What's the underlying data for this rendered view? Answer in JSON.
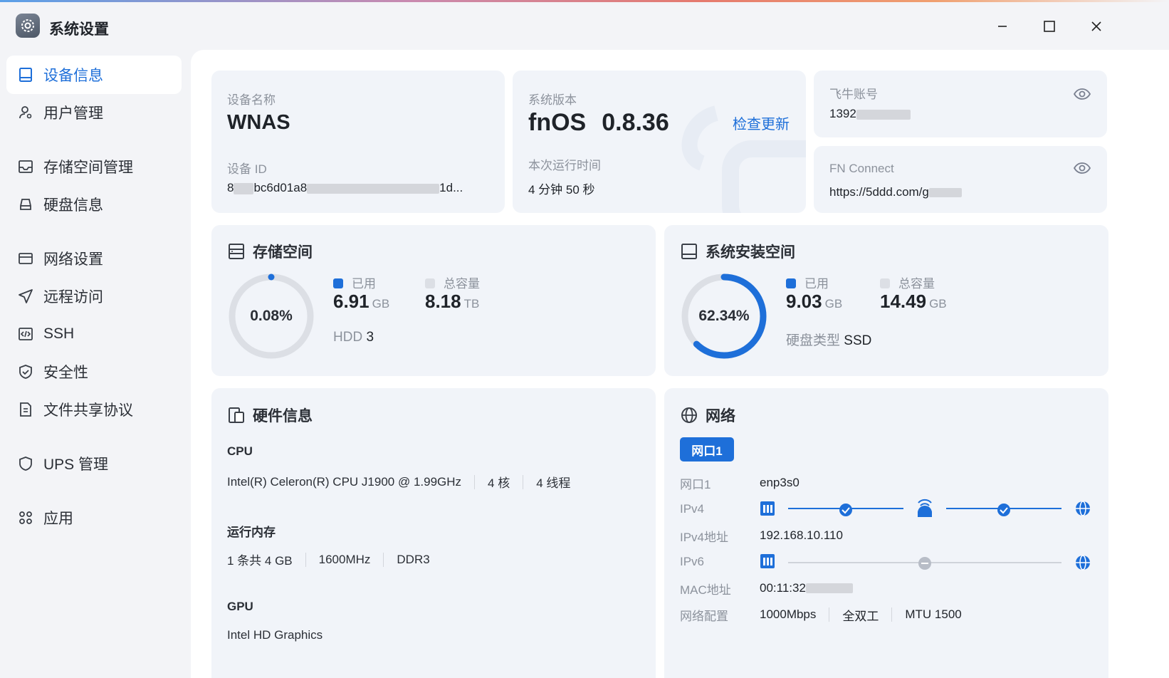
{
  "app": {
    "title": "系统设置"
  },
  "sidebar": {
    "items": [
      {
        "label": "设备信息",
        "icon": "device-icon"
      },
      {
        "label": "用户管理",
        "icon": "user-icon"
      },
      {
        "label": "存储空间管理",
        "icon": "storage-icon"
      },
      {
        "label": "硬盘信息",
        "icon": "disk-icon"
      },
      {
        "label": "网络设置",
        "icon": "network-settings-icon"
      },
      {
        "label": "远程访问",
        "icon": "send-icon"
      },
      {
        "label": "SSH",
        "icon": "code-icon"
      },
      {
        "label": "安全性",
        "icon": "shield-check-icon"
      },
      {
        "label": "文件共享协议",
        "icon": "document-icon"
      },
      {
        "label": "UPS 管理",
        "icon": "shield-icon"
      },
      {
        "label": "应用",
        "icon": "apps-icon"
      }
    ]
  },
  "device": {
    "name_label": "设备名称",
    "name": "WNAS",
    "id_label": "设备 ID",
    "id_start": "8",
    "id_mid": "bc6d01a8",
    "id_end": "1d..."
  },
  "system": {
    "version_label": "系统版本",
    "os": "fnOS",
    "version": "0.8.36",
    "check_update": "检查更新",
    "uptime_label": "本次运行时间",
    "uptime": "4 分钟 50 秒"
  },
  "account": {
    "label": "飞牛账号",
    "value": "1392"
  },
  "fnconnect": {
    "label": "FN Connect",
    "value": "https://5ddd.com/g"
  },
  "storage": {
    "title": "存储空间",
    "percent": "0.08%",
    "percent_value": 0.08,
    "used_label": "已用",
    "used_value": "6.91",
    "used_unit": "GB",
    "total_label": "总容量",
    "total_value": "8.18",
    "total_unit": "TB",
    "hdd_label": "HDD",
    "hdd_count": "3"
  },
  "sysinstall": {
    "title": "系统安装空间",
    "percent": "62.34%",
    "percent_value": 62.34,
    "used_label": "已用",
    "used_value": "9.03",
    "used_unit": "GB",
    "total_label": "总容量",
    "total_value": "14.49",
    "total_unit": "GB",
    "disk_type_label": "硬盘类型",
    "disk_type": "SSD"
  },
  "hardware": {
    "title": "硬件信息",
    "cpu_label": "CPU",
    "cpu_model": "Intel(R) Celeron(R) CPU J1900 @ 1.99GHz",
    "cpu_cores": "4 核",
    "cpu_threads": "4 线程",
    "mem_label": "运行内存",
    "mem_size": "1 条共 4 GB",
    "mem_freq": "1600MHz",
    "mem_type": "DDR3",
    "gpu_label": "GPU",
    "gpu_model": "Intel HD Graphics"
  },
  "network": {
    "title": "网络",
    "port_tab": "网口1",
    "rows": {
      "port_k": "网口1",
      "port_v": "enp3s0",
      "ipv4_k": "IPv4",
      "ipv4addr_k": "IPv4地址",
      "ipv4addr_v": "192.168.10.110",
      "ipv6_k": "IPv6",
      "mac_k": "MAC地址",
      "mac_v": "00:11:32",
      "cfg_k": "网络配置",
      "cfg_speed": "1000Mbps",
      "cfg_duplex": "全双工",
      "cfg_mtu": "MTU 1500"
    }
  },
  "colors": {
    "accent": "#1e6fd9",
    "card": "#f1f4f9",
    "ring_track": "#dcdfe5",
    "muted": "#8c929c"
  }
}
